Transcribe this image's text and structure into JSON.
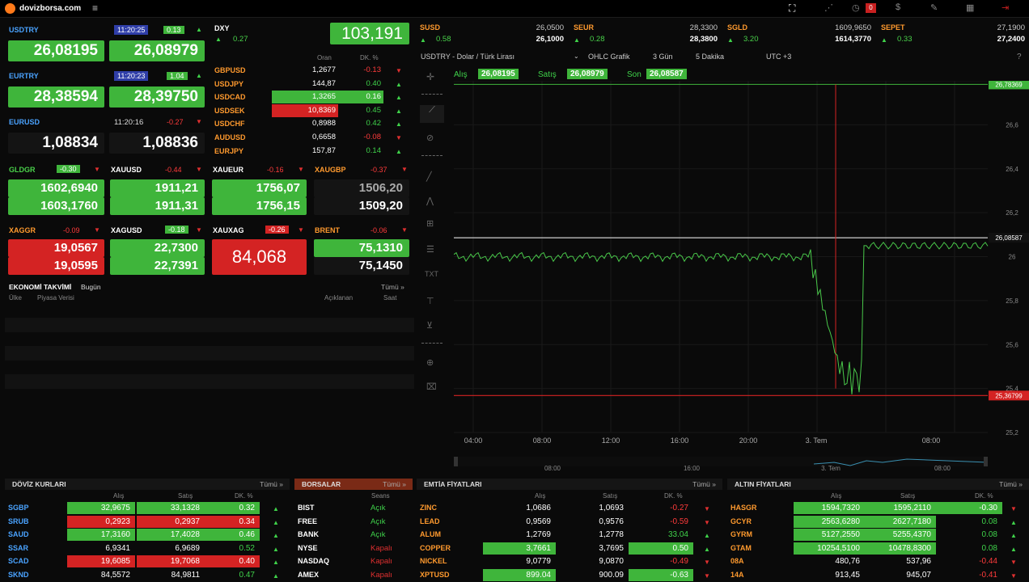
{
  "app": {
    "title": "dovizborsa.com"
  },
  "tiles": {
    "usdtry": {
      "name": "USDTRY",
      "time": "11:20:25",
      "change": "0.13",
      "bid": "26,08195",
      "ask": "26,08979"
    },
    "eurtry": {
      "name": "EURTRY",
      "time": "11:20:23",
      "change": "1.04",
      "bid": "28,38594",
      "ask": "28,39750"
    },
    "eurusd": {
      "name": "EURUSD",
      "time": "11:20:16",
      "change": "-0.27",
      "bid": "1,08834",
      "ask": "1,08836"
    },
    "gldgr": {
      "name": "GLDGR",
      "change": "-0.30",
      "bid": "1602,6940",
      "ask": "1603,1760"
    },
    "xauusd": {
      "name": "XAUUSD",
      "change": "-0.44",
      "bid": "1911,21",
      "ask": "1911,31"
    },
    "xaueur": {
      "name": "XAUEUR",
      "change": "-0.16",
      "bid": "1756,07",
      "ask": "1756,15"
    },
    "xaugbp": {
      "name": "XAUGBP",
      "change": "-0.37",
      "bid": "1506,20",
      "ask": "1509,20"
    },
    "xaggr": {
      "name": "XAGGR",
      "change": "-0.09",
      "bid": "19,0567",
      "ask": "19,0595"
    },
    "xagusd": {
      "name": "XAGUSD",
      "change": "-0.18",
      "bid": "22,7300",
      "ask": "22,7391"
    },
    "xauxag": {
      "name": "XAUXAG",
      "change": "-0.26",
      "value": "84,068"
    },
    "brent": {
      "name": "BRENT",
      "change": "-0.06",
      "bid": "75,1310",
      "ask": "75,1450"
    }
  },
  "dxy": {
    "name": "DXY",
    "change": "0.27",
    "value": "103,191"
  },
  "fx_mini": {
    "h_rate": "Oran",
    "h_chg": "DK. %",
    "rows": [
      {
        "name": "GBPUSD",
        "rate": "1,2677",
        "chg": "-0.13",
        "dir": "down"
      },
      {
        "name": "USDJPY",
        "rate": "144,87",
        "chg": "0.40",
        "dir": "up"
      },
      {
        "name": "USDCAD",
        "rate": "1,3265",
        "chg": "0.16",
        "dir": "up"
      },
      {
        "name": "USDSEK",
        "rate": "10,8369",
        "chg": "0.45",
        "dir": "up"
      },
      {
        "name": "USDCHF",
        "rate": "0,8988",
        "chg": "0.42",
        "dir": "up"
      },
      {
        "name": "AUDUSD",
        "rate": "0,6658",
        "chg": "-0.08",
        "dir": "down"
      },
      {
        "name": "EURJPY",
        "rate": "157,87",
        "chg": "0.14",
        "dir": "up"
      }
    ]
  },
  "calendar": {
    "title": "EKONOMİ TAKVİMİ",
    "sub": "Bugün",
    "all": "Tümü »",
    "h_country": "Ülke",
    "h_data": "Piyasa Verisi",
    "h_announced": "Açıklanan",
    "h_time": "Saat"
  },
  "top_quotes": [
    {
      "name": "SUSD",
      "change": "0.58",
      "bid": "26,0500",
      "ask": "26,1000"
    },
    {
      "name": "SEUR",
      "change": "0.28",
      "bid": "28,3300",
      "ask": "28,3800"
    },
    {
      "name": "SGLD",
      "change": "3.20",
      "bid": "1609,9650",
      "ask": "1614,3770"
    },
    {
      "name": "SEPET",
      "change": "0.33",
      "bid": "27,1900",
      "ask": "27,2400"
    }
  ],
  "chart_toolbar": {
    "symbol": "USDTRY - Dolar / Türk Lirası",
    "type": "OHLC Grafik",
    "range": "3 Gün",
    "interval": "5 Dakika",
    "tz": "UTC +3"
  },
  "chart_info": {
    "bid_label": "Alış",
    "bid": "26,08195",
    "ask_label": "Satış",
    "ask": "26,08979",
    "last_label": "Son",
    "last": "26,08587"
  },
  "chart_data": {
    "type": "line",
    "symbol": "USDTRY",
    "y_ticks": [
      "26,8",
      "26,6",
      "26,4",
      "26,2",
      "26",
      "25,8",
      "25,6",
      "25,4",
      "25,2"
    ],
    "x_ticks": [
      "04:00",
      "08:00",
      "12:00",
      "16:00",
      "20:00",
      "3. Tem",
      "08:00"
    ],
    "nav_ticks": [
      "08:00",
      "16:00",
      "3. Tem",
      "08:00"
    ],
    "ylim": [
      25.2,
      26.8
    ],
    "hi_line": "26,78369",
    "lo_line": "25,36799",
    "last_line": "26,08587"
  },
  "sections": {
    "doviz": {
      "title": "DÖVİZ KURLARI",
      "all": "Tümü »",
      "h1": "Alış",
      "h2": "Satış",
      "h3": "DK. %",
      "rows": [
        {
          "name": "SGBP",
          "bid": "32,9675",
          "ask": "33,1328",
          "chg": "0.32",
          "dir": "up",
          "bg": "g"
        },
        {
          "name": "SRUB",
          "bid": "0,2923",
          "ask": "0,2937",
          "chg": "0.34",
          "dir": "up",
          "bg": "r"
        },
        {
          "name": "SAUD",
          "bid": "17,3160",
          "ask": "17,4028",
          "chg": "0.46",
          "dir": "up",
          "bg": "g"
        },
        {
          "name": "SSAR",
          "bid": "6,9341",
          "ask": "6,9689",
          "chg": "0.52",
          "dir": "up",
          "bg": "k"
        },
        {
          "name": "SCAD",
          "bid": "19,6085",
          "ask": "19,7068",
          "chg": "0.40",
          "dir": "up",
          "bg": "r"
        },
        {
          "name": "SKND",
          "bid": "84,5572",
          "ask": "84,9811",
          "chg": "0.47",
          "dir": "up",
          "bg": "k"
        }
      ]
    },
    "borsalar": {
      "title": "BORSALAR",
      "all": "Tümü »",
      "h1": "Seans",
      "rows": [
        {
          "name": "BIST",
          "status": "Açık",
          "open": true
        },
        {
          "name": "FREE",
          "status": "Açık",
          "open": true
        },
        {
          "name": "BANK",
          "status": "Açık",
          "open": true
        },
        {
          "name": "NYSE",
          "status": "Kapalı",
          "open": false
        },
        {
          "name": "NASDAQ",
          "status": "Kapalı",
          "open": false
        },
        {
          "name": "AMEX",
          "status": "Kapalı",
          "open": false
        }
      ]
    },
    "emtia": {
      "title": "EMTİA FİYATLARI",
      "all": "Tümü »",
      "h1": "Alış",
      "h2": "Satış",
      "h3": "DK. %",
      "rows": [
        {
          "name": "ZINC",
          "bid": "1,0686",
          "ask": "1,0693",
          "chg": "-0.27",
          "dir": "down",
          "bg": "k"
        },
        {
          "name": "LEAD",
          "bid": "0,9569",
          "ask": "0,9576",
          "chg": "-0.59",
          "dir": "down",
          "bg": "k"
        },
        {
          "name": "ALUM",
          "bid": "1,2769",
          "ask": "1,2778",
          "chg": "33.04",
          "dir": "up",
          "bg": "k"
        },
        {
          "name": "COPPER",
          "bid": "3,7661",
          "ask": "3,7695",
          "chg": "0.50",
          "dir": "up",
          "bg": "g"
        },
        {
          "name": "NICKEL",
          "bid": "9,0779",
          "ask": "9,0870",
          "chg": "-0.49",
          "dir": "down",
          "bg": "k"
        },
        {
          "name": "XPTUSD",
          "bid": "899.04",
          "ask": "900.09",
          "chg": "-0.63",
          "dir": "down",
          "bg": "g"
        }
      ]
    },
    "altin": {
      "title": "ALTIN FİYATLARI",
      "all": "Tümü »",
      "h1": "Alış",
      "h2": "Satış",
      "h3": "DK. %",
      "rows": [
        {
          "name": "HASGR",
          "bid": "1594,7320",
          "ask": "1595,2110",
          "chg": "-0.30",
          "dir": "down",
          "bg": "g"
        },
        {
          "name": "GCYR",
          "bid": "2563,6280",
          "ask": "2627,7180",
          "chg": "0.08",
          "dir": "up",
          "bg": "g"
        },
        {
          "name": "GYRM",
          "bid": "5127,2550",
          "ask": "5255,4370",
          "chg": "0.08",
          "dir": "up",
          "bg": "g"
        },
        {
          "name": "GTAM",
          "bid": "10254,5100",
          "ask": "10478,8300",
          "chg": "0.08",
          "dir": "up",
          "bg": "g"
        },
        {
          "name": "08A",
          "bid": "480,76",
          "ask": "537,96",
          "chg": "-0.44",
          "dir": "down",
          "bg": "k"
        },
        {
          "name": "14A",
          "bid": "913,45",
          "ask": "945,07",
          "chg": "-0.41",
          "dir": "down",
          "bg": "k"
        }
      ]
    }
  }
}
